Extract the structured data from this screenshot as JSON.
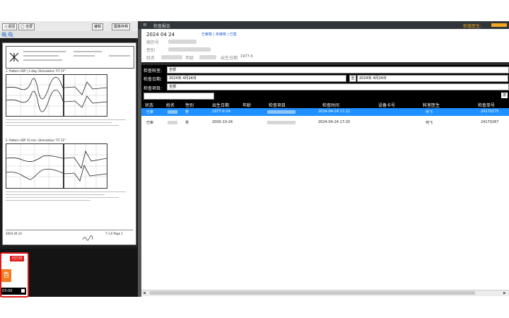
{
  "left_toolbar": {
    "btn1": "◁ 返回",
    "btn2": "◯ 全屏",
    "btn3": "编辑",
    "btn4": "图像存档"
  },
  "zoom": {
    "in_icon": "zoom-in-icon",
    "out_icon": "zoom-out-icon"
  },
  "report": {
    "section1": "1. Pattern VEP | 2 deg: Stimulation \"FF 1F\"",
    "section2": "2. Pattern VEP 15 min: Stimulation \"FF 1F\"",
    "footer_left": "2024 04 24",
    "footer_right": "7.1.0 Page 1"
  },
  "thumbnail": {
    "tag": "已打印",
    "char": "告",
    "time": "03:00"
  },
  "topbar": {
    "title": "检查报告",
    "right": "检查医生:"
  },
  "info": {
    "date": "2024  04  24",
    "status_text": "已审核 | 未审核 | 已签",
    "label_name": "姓名",
    "label_age": "年龄",
    "label_sex": "性别",
    "label_dob": "出生日期",
    "label_id": "病历号",
    "dob_value": "1977-0"
  },
  "filter": {
    "label_dept": "检查科室:",
    "dept_value": "全部",
    "label_date": "检查日期:",
    "date_from": "2024年 4月24日",
    "date_to": "2024年 4月24日",
    "label_item": "检查项目:",
    "item_value": "全部",
    "search_label": "搜"
  },
  "table": {
    "headers": [
      "状态",
      "姓名",
      "性别",
      "出生日期",
      "年龄",
      "检查项目",
      "检查时间",
      "设备卡号",
      "科室医生",
      "检查单号"
    ],
    "rows": [
      [
        "已审",
        "",
        "男",
        "1977-0-24",
        "",
        "",
        "2024-04-24 17:22",
        "",
        "何飞",
        "24170275"
      ],
      [
        "已审",
        "",
        "男",
        "2000-10-24",
        "",
        "",
        "2024-04-24 17:20",
        "",
        "何飞",
        "24170267"
      ]
    ]
  },
  "colors": {
    "accent": "#f5a623",
    "selected": "#1e90ff",
    "status_blue": "#1a4fd6",
    "status_red": "#d42020"
  }
}
